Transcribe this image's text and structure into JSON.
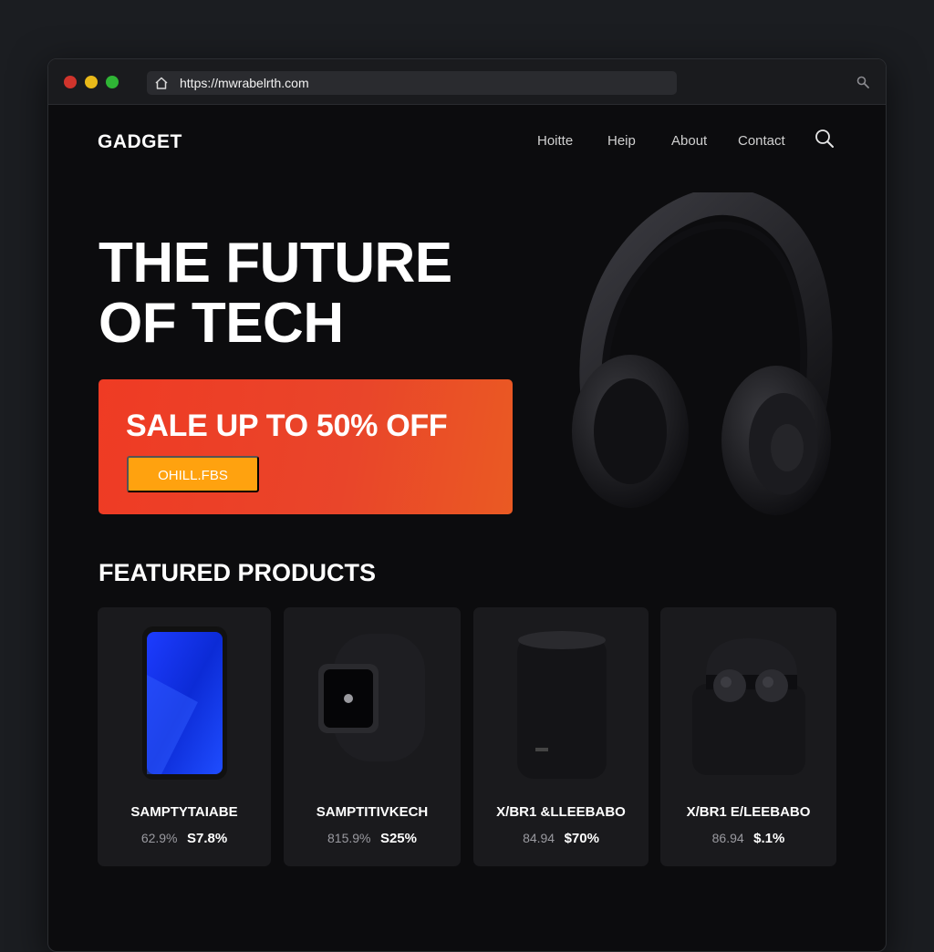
{
  "browser": {
    "url": "https://mwrabelrth.com",
    "icons": {
      "home": "home-icon",
      "search": "search-icon"
    },
    "traffic_lights": [
      "#d0342c",
      "#e9b919",
      "#2fb535"
    ]
  },
  "site": {
    "logo": "GADGET",
    "nav": [
      "Hoitte",
      "Heip",
      "About",
      "Contact"
    ],
    "nav_search_icon": "search-icon"
  },
  "hero": {
    "title": "THE FUTURE OF TECH",
    "promo_text": "SALE UP TO 50% OFF",
    "promo_button": "OHILL.FBS",
    "image": "headphones"
  },
  "featured": {
    "title": "FEATURED PRODUCTS",
    "products": [
      {
        "name": "SAMPTYTAIABE",
        "old_price": "62.9%",
        "price": "S7.8%",
        "image": "smartphone"
      },
      {
        "name": "SAMPTITIVKECH",
        "old_price": "815.9%",
        "price": "S25%",
        "image": "smartwatch"
      },
      {
        "name": "X/BR1 &LLEEBABO",
        "old_price": "84.94",
        "price": "$70%",
        "image": "smart-speaker"
      },
      {
        "name": "X/BR1 E/LEEBABO",
        "old_price": "86.94",
        "price": "$.1%",
        "image": "earbuds"
      }
    ]
  },
  "colors": {
    "accent": "#ef3b24",
    "button": "#ffa20f",
    "background": "#0c0c0e",
    "card": "#1a1a1d"
  }
}
